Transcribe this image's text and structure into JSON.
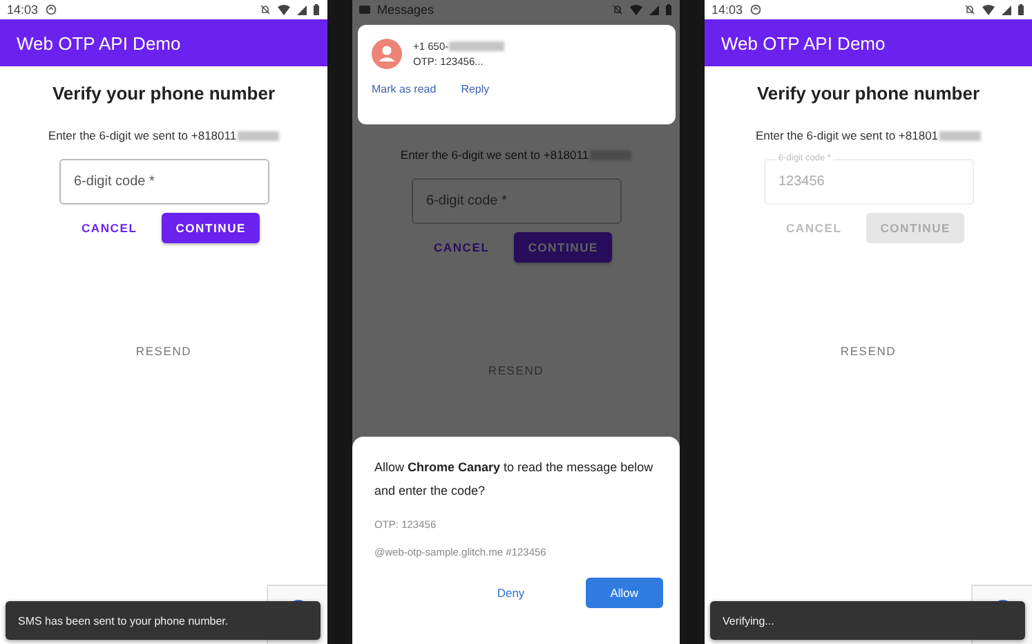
{
  "screens": [
    {
      "dimmed": false,
      "status_bar": {
        "time": "14:03"
      },
      "app_bar": {
        "title": "Web OTP API Demo"
      },
      "heading": "Verify your phone number",
      "instruction": "Enter the 6-digit we sent to +818011",
      "code_field": {
        "placeholder": "6-digit code *",
        "disabled": false
      },
      "buttons": [
        {
          "label": "CANCEL",
          "kind": "text",
          "disabled": false
        },
        {
          "label": "CONTINUE",
          "kind": "filled",
          "disabled": false
        }
      ],
      "resend": "RESEND",
      "snackbar": "SMS has been sent to your phone number."
    },
    {
      "dimmed": true,
      "status_bar": {
        "app": "Messages"
      },
      "notification": {
        "sender": "+1 650-",
        "preview": "OTP: 123456...",
        "actions": [
          "Mark as read",
          "Reply"
        ]
      },
      "instruction": "Enter the 6-digit we sent to +818011",
      "code_field": {
        "placeholder": "6-digit code *",
        "disabled": false
      },
      "buttons": [
        {
          "label": "CANCEL",
          "kind": "text",
          "disabled": false
        },
        {
          "label": "CONTINUE",
          "kind": "filled",
          "disabled": false
        }
      ],
      "resend": "RESEND",
      "dialog": {
        "prompt": "Allow **Chrome Canary** to read the message below and enter the code?",
        "lines": [
          "OTP: 123456",
          "@web-otp-sample.glitch.me #123456"
        ],
        "buttons": [
          {
            "label": "Deny",
            "kind": "text"
          },
          {
            "label": "Allow",
            "kind": "filled"
          }
        ]
      }
    },
    {
      "dimmed": false,
      "status_bar": {
        "time": "14:03"
      },
      "app_bar": {
        "title": "Web OTP API Demo"
      },
      "heading": "Verify your phone number",
      "instruction": "Enter the 6-digit we sent to +81801",
      "code_field": {
        "label": "6-digit code *",
        "value": "123456",
        "disabled": true
      },
      "buttons": [
        {
          "label": "CANCEL",
          "kind": "text",
          "disabled": true
        },
        {
          "label": "CONTINUE",
          "kind": "filled",
          "disabled": true
        }
      ],
      "resend": "RESEND",
      "snackbar": "Verifying..."
    }
  ]
}
